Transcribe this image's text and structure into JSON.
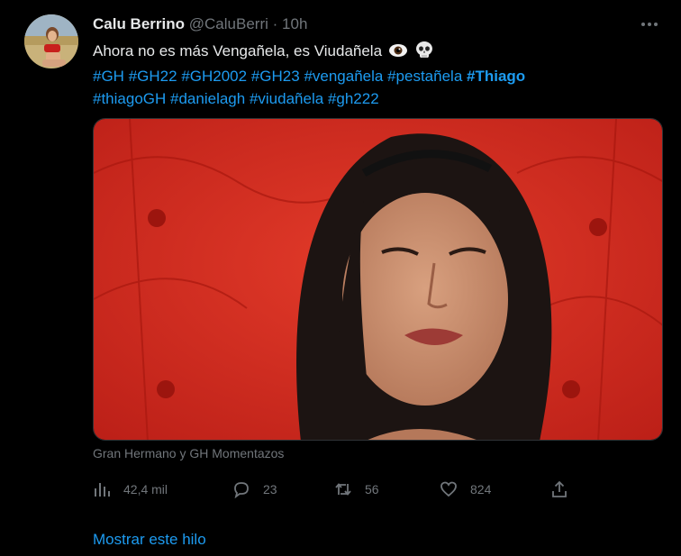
{
  "tweet": {
    "author_name": "Calu Berrino",
    "handle": "@CaluBerri",
    "separator": "·",
    "time": "10h",
    "more_icon": "ellipsis-icon",
    "text": "Ahora no es más Vengañela, es Viudañela",
    "emojis": [
      "eye-emoji",
      "skull-emoji"
    ],
    "hashtags_line1": [
      "#GH",
      "#GH22",
      "#GH2002",
      "#GH23",
      "#vengañela",
      "#pestañela"
    ],
    "hashtag_bold": "#Thiago",
    "hashtags_line2": [
      "#thiagoGH",
      "#danielagh",
      "#viudañela",
      "#gh222"
    ],
    "media_caption": "Gran Hermano y GH Momentazos",
    "show_thread": "Mostrar este hilo"
  },
  "actions": {
    "views": "42,4 mil",
    "replies": "23",
    "retweets": "56",
    "likes": "824"
  },
  "colors": {
    "background": "#000000",
    "text": "#e7e9ea",
    "muted": "#71767b",
    "link": "#1d9bf0",
    "media_red": "#d52a1f"
  }
}
